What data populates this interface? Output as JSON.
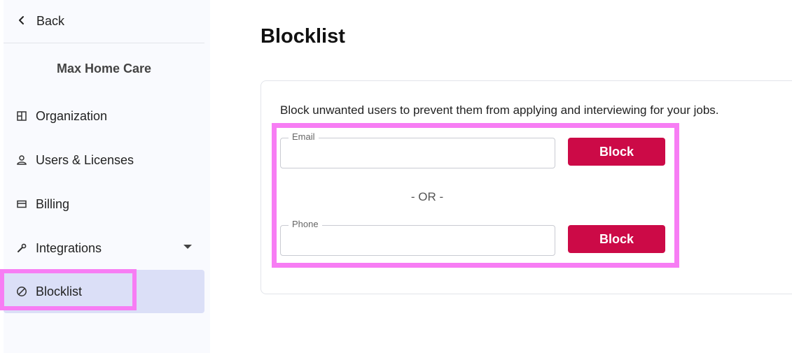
{
  "sidebar": {
    "back_label": "Back",
    "org_name": "Max Home Care",
    "items": [
      {
        "label": "Organization",
        "icon": "layout-icon"
      },
      {
        "label": "Users & Licenses",
        "icon": "user-icon"
      },
      {
        "label": "Billing",
        "icon": "credit-card-icon"
      },
      {
        "label": "Integrations",
        "icon": "wrench-icon"
      },
      {
        "label": "Blocklist",
        "icon": "block-icon"
      }
    ],
    "active": "Blocklist"
  },
  "main": {
    "title": "Blocklist",
    "description": "Block unwanted users to prevent them from applying and interviewing for your jobs.",
    "email": {
      "label": "Email",
      "value": ""
    },
    "phone": {
      "label": "Phone",
      "value": ""
    },
    "or_text": "- OR -",
    "block_label": "Block"
  },
  "colors": {
    "accent": "#cc0a47",
    "active_nav_bg": "#dbdff7",
    "highlight": "#f77df4"
  }
}
